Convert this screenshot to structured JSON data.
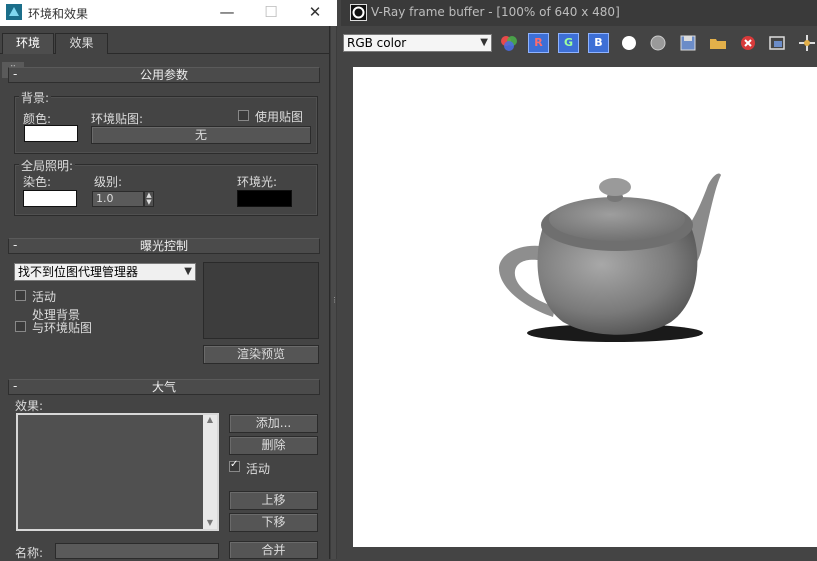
{
  "left_window": {
    "title": "环境和效果",
    "tabs": [
      {
        "label": "环境",
        "active": true
      },
      {
        "label": "效果",
        "active": false
      }
    ],
    "common_params": {
      "title": "公用参数",
      "background": {
        "group_label": "背景:",
        "color_label": "颜色:",
        "color": "#ffffff",
        "env_map_label": "环境贴图:",
        "use_map_label": "使用贴图",
        "use_map_checked": false,
        "map_button": "无"
      },
      "global_lighting": {
        "group_label": "全局照明:",
        "tint_label": "染色:",
        "tint_color": "#ffffff",
        "level_label": "级别:",
        "level_value": "1.0",
        "ambient_label": "环境光:",
        "ambient_color": "#000000"
      }
    },
    "exposure": {
      "title": "曝光控制",
      "dropdown_value": "找不到位图代理管理器",
      "active_label": "活动",
      "active_checked": false,
      "process_bg_label_1": "处理背景",
      "process_bg_label_2": "与环境贴图",
      "process_bg_checked": false,
      "render_preview": "渲染预览"
    },
    "atmosphere": {
      "title": "大气",
      "effects_label": "效果:",
      "add_button": "添加...",
      "delete_button": "删除",
      "active_label": "活动",
      "active_checked": true,
      "move_up": "上移",
      "move_down": "下移",
      "name_label": "名称:",
      "merge_button": "合并"
    }
  },
  "right_window": {
    "title": "V-Ray frame buffer - [100% of 640 x 480]",
    "channel_dropdown": "RGB color",
    "channel_buttons": [
      "R",
      "G",
      "B"
    ],
    "toolbar_icons": [
      "color-balls-icon",
      "red-channel",
      "green-channel",
      "blue-channel",
      "white-circle-icon",
      "gray-circle-icon",
      "save-icon",
      "open-folder-icon",
      "clear-icon",
      "region-icon",
      "crosshair-icon"
    ]
  }
}
